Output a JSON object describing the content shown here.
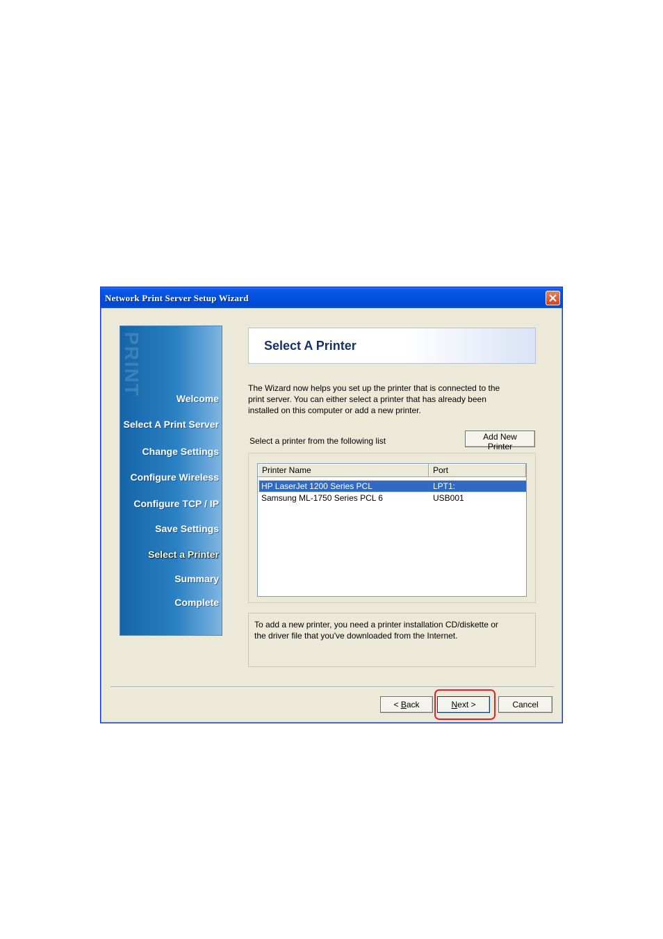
{
  "window": {
    "title": "Network Print Server Setup Wizard",
    "close_label": "close"
  },
  "sidebar": {
    "watermark": "PRINT",
    "steps": [
      {
        "label": "Welcome",
        "active": false
      },
      {
        "label": "Select A Print Server",
        "active": false
      },
      {
        "label": "Change Settings",
        "active": false
      },
      {
        "label": "Configure Wireless",
        "active": false
      },
      {
        "label": "Configure TCP / IP",
        "active": false
      },
      {
        "label": "Save Settings",
        "active": false
      },
      {
        "label": "Select a Printer",
        "active": true
      },
      {
        "label": "Summary",
        "active": false
      },
      {
        "label": "Complete",
        "active": false
      }
    ]
  },
  "header": {
    "title": "Select A Printer"
  },
  "description": {
    "line1": "The Wizard now helps you set up the printer that is connected to the",
    "line2": "print server. You can either select a printer that has already been",
    "line3": "installed on this computer or add a new printer."
  },
  "printer_list": {
    "label": "Select a printer from the following list",
    "add_button": "Add New Printer",
    "columns": [
      "Printer Name",
      "Port"
    ],
    "rows": [
      {
        "name": "HP LaserJet 1200 Series PCL",
        "port": "LPT1:",
        "selected": true
      },
      {
        "name": "Samsung ML-1750 Series PCL 6",
        "port": "USB001",
        "selected": false
      }
    ]
  },
  "info": {
    "line1": "To add a new printer, you need a printer installation CD/diskette or",
    "line2": "the driver file that you've downloaded from the Internet."
  },
  "buttons": {
    "back_prefix": "< ",
    "back_key": "B",
    "back_rest": "ack",
    "next_key": "N",
    "next_rest": "ext >",
    "cancel": "Cancel"
  },
  "colors": {
    "title_bar": "#0250dc",
    "selection": "#316ac5",
    "highlight_ring": "#e0222c"
  }
}
